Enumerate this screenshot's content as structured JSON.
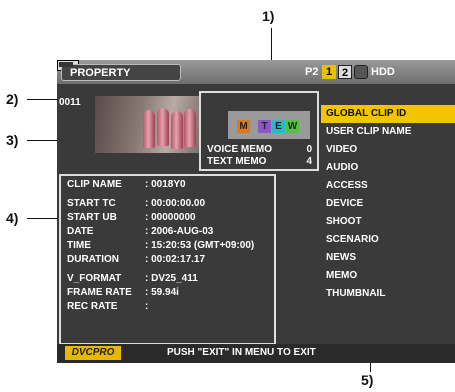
{
  "callouts": {
    "c1": "1)",
    "c2": "2)",
    "c3": "3)",
    "c4": "4)",
    "c5": "5)"
  },
  "header": {
    "title": "PROPERTY",
    "p2": "P2",
    "slot1": "1",
    "slot2": "2",
    "hdd": "HDD"
  },
  "clip_number": "0011",
  "memo": {
    "flags": [
      "M",
      "T",
      "E",
      "W"
    ],
    "voice_label": "VOICE MEMO",
    "voice_count": "0",
    "text_label": "TEXT MEMO",
    "text_count": "4"
  },
  "info": {
    "clip_name_key": "CLIP NAME",
    "clip_name": ": 0018Y0",
    "start_tc_key": "START TC",
    "start_tc": ": 00:00:00.00",
    "start_ub_key": "START UB",
    "start_ub": ": 00000000",
    "date_key": "DATE",
    "date": ": 2006-AUG-03",
    "time_key": "TIME",
    "time": ": 15:20:53 (GMT+09:00)",
    "duration_key": "DURATION",
    "duration": ": 00:02:17.17",
    "vformat_key": "V_FORMAT",
    "vformat": ": DV25_411",
    "framerate_key": "FRAME RATE",
    "framerate": ": 59.94i",
    "recrate_key": "REC RATE",
    "recrate": ":"
  },
  "menu": {
    "items": [
      "GLOBAL CLIP ID",
      "USER CLIP NAME",
      "VIDEO",
      "AUDIO",
      "ACCESS",
      "DEVICE",
      "SHOOT",
      "SCENARIO",
      "NEWS",
      "MEMO",
      "THUMBNAIL"
    ],
    "selected": "GLOBAL CLIP ID"
  },
  "footer": {
    "logo": "DVCPRO",
    "message": "PUSH \"EXIT\" IN MENU TO EXIT"
  }
}
